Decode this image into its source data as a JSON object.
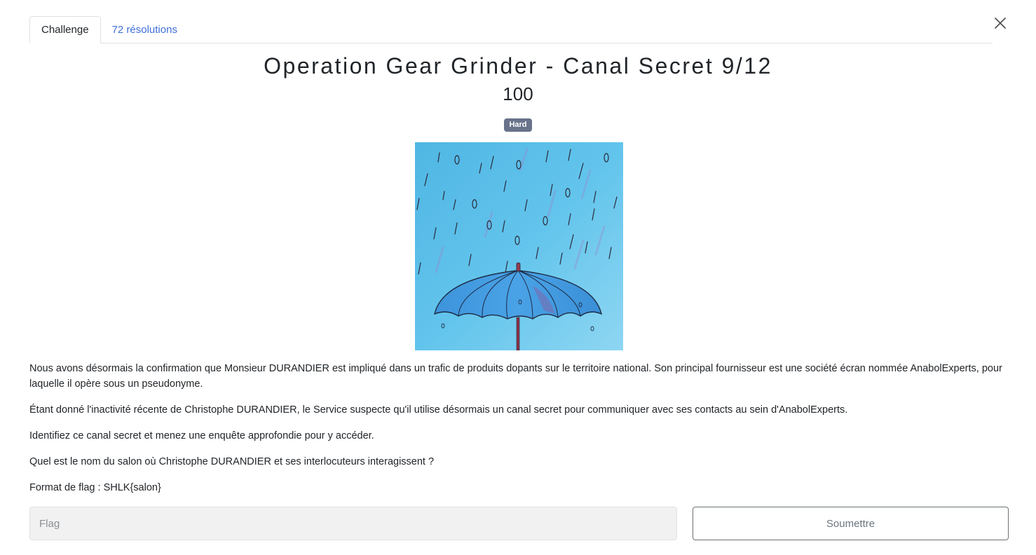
{
  "tabs": {
    "challenge": "Challenge",
    "solves": "72 résolutions"
  },
  "challenge": {
    "title": "Operation Gear Grinder - Canal Secret 9/12",
    "points": "100",
    "difficulty": "Hard",
    "image_description": "watercolor-umbrella-binary-rain"
  },
  "description": {
    "p1": "Nous avons désormais la confirmation que Monsieur DURANDIER est impliqué dans un trafic de produits dopants sur le territoire national. Son principal fournisseur est une société écran nommée AnabolExperts, pour laquelle il opère sous un pseudonyme.",
    "p2": "Étant donné l'inactivité récente de Christophe DURANDIER, le Service suspecte qu'il utilise désormais un canal secret pour communiquer avec ses contacts au sein d'AnabolExperts.",
    "p3": "Identifiez ce canal secret et menez une enquête approfondie pour y accéder.",
    "p4": "Quel est le nom du salon où Christophe DURANDIER et ses interlocuteurs interagissent ?",
    "p5": "Format de flag : SHLK{salon}"
  },
  "form": {
    "flag_placeholder": "Flag",
    "flag_value": "",
    "submit_label": "Soumettre"
  },
  "icons": {
    "close": "close-icon"
  },
  "colors": {
    "badge": "#68728a",
    "link": "#3f6fd8",
    "input_bg": "#f1f1f1"
  }
}
